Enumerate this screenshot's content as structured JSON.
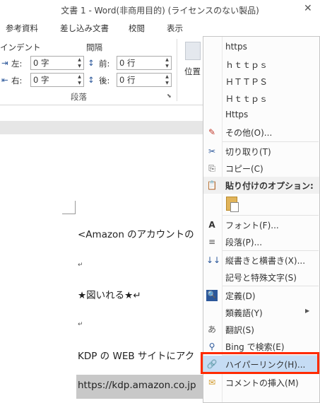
{
  "window": {
    "title": "文書 1 - Word(非商用目的) (ライセンスのない製品)"
  },
  "tabs": [
    "参考資料",
    "差し込み文書",
    "校閲",
    "表示"
  ],
  "ribbon": {
    "indent_label": "インデント",
    "spacing_label": "間隔",
    "left_label": "左:",
    "right_label": "右:",
    "before_label": "前:",
    "after_label": "後:",
    "left_value": "0 字",
    "right_value": "0 字",
    "before_value": "0 行",
    "after_value": "0 行",
    "group_label": "段落",
    "position_label": "位置"
  },
  "document": {
    "lines": [
      "<Amazon のアカウントの",
      "↵",
      "★図いれる★↵",
      "↵",
      "KDP の WEB サイトにアク",
      "https://kdp.amazon.co.jp"
    ]
  },
  "context_menu": {
    "items": [
      {
        "label": "https",
        "icon": ""
      },
      {
        "label": "ｈｔｔｐｓ",
        "icon": ""
      },
      {
        "label": "ＨＴＴＰＳ",
        "icon": ""
      },
      {
        "label": "Ｈｔｔｐｓ",
        "icon": ""
      },
      {
        "label": "Https",
        "icon": ""
      },
      {
        "label": "その他(O)...",
        "icon": "more-icon"
      },
      {
        "label": "切り取り(T)",
        "icon": "scissors-icon"
      },
      {
        "label": "コピー(C)",
        "icon": "copy-icon"
      },
      {
        "label": "貼り付けのオプション:",
        "icon": "paste-icon"
      },
      {
        "label": "フォント(F)...",
        "icon": "font-icon"
      },
      {
        "label": "段落(P)...",
        "icon": "paragraph-icon"
      },
      {
        "label": "縦書きと横書き(X)...",
        "icon": "text-direction-icon"
      },
      {
        "label": "記号と特殊文字(S)",
        "icon": ""
      },
      {
        "label": "定義(D)",
        "icon": "define-icon"
      },
      {
        "label": "類義語(Y)",
        "icon": ""
      },
      {
        "label": "翻訳(S)",
        "icon": "translate-icon"
      },
      {
        "label": "Bing で検索(E)",
        "icon": "search-icon"
      },
      {
        "label": "ハイパーリンク(H)...",
        "icon": "link-icon"
      },
      {
        "label": "コメントの挿入(M)",
        "icon": "comment-icon"
      }
    ]
  }
}
